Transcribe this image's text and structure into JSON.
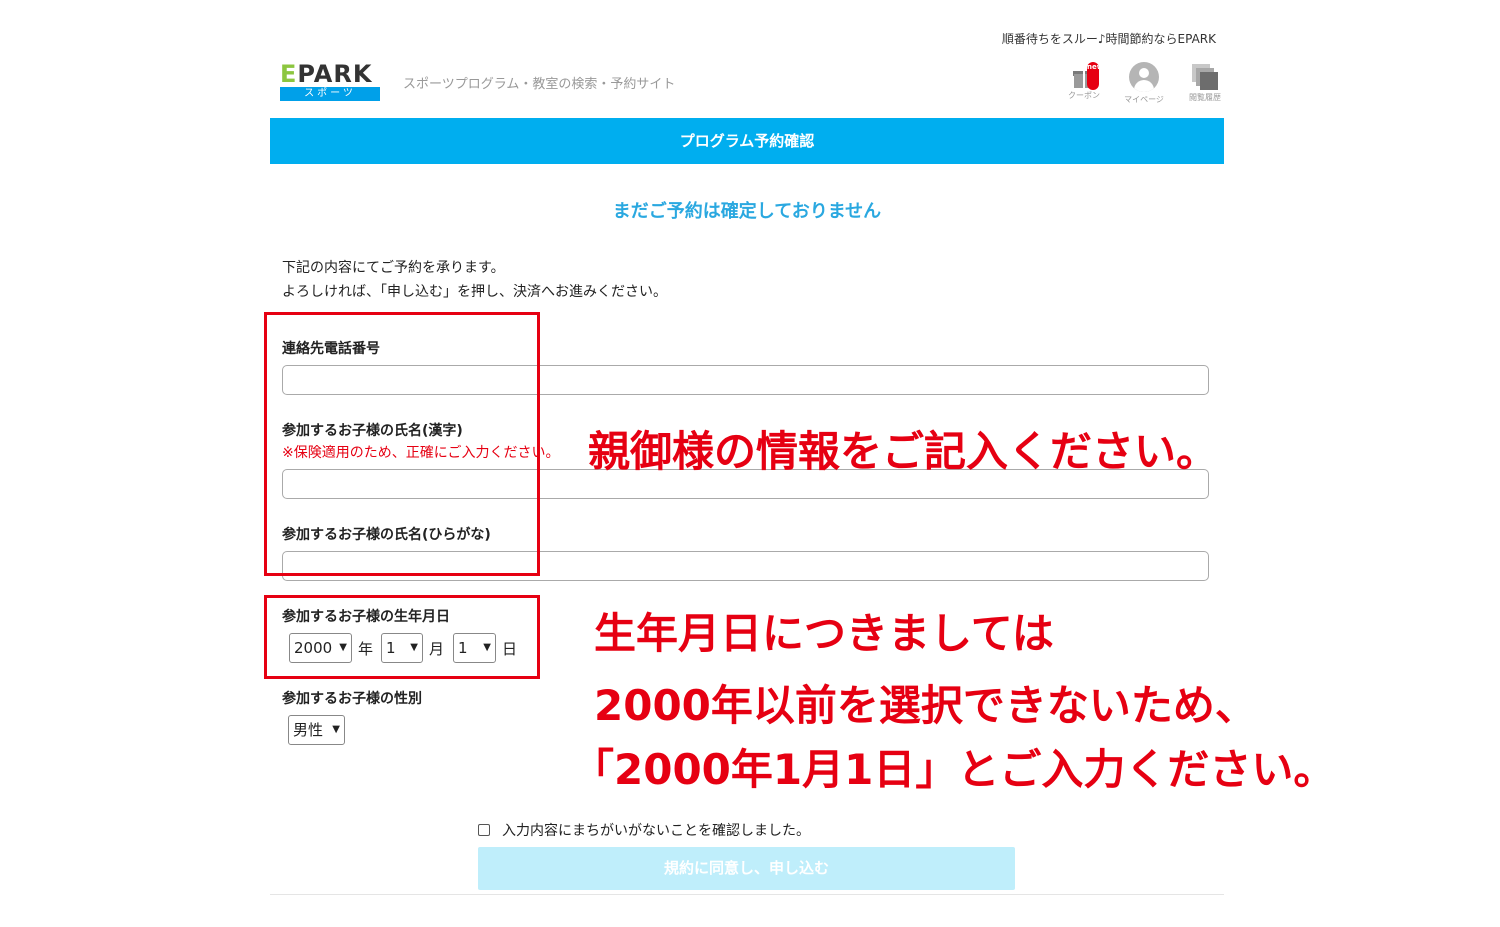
{
  "header": {
    "tagline": "順番待ちをスルー♪時間節約ならEPARK",
    "logo_letter": "E",
    "logo_word": "PARK",
    "logo_sub": "スポーツ",
    "site_description": "スポーツプログラム・教室の検索・予約サイト",
    "icons": [
      {
        "name": "gift-icon",
        "label": "クーポン",
        "badge": "new"
      },
      {
        "name": "user-icon",
        "label": "マイページ"
      },
      {
        "name": "history-icon",
        "label": "閲覧履歴"
      }
    ]
  },
  "banner": {
    "title": "プログラム予約確認"
  },
  "notice": "まだご予約は確定しておりません",
  "intro": {
    "line1": "下記の内容にてご予約を承ります。",
    "line2": "よろしければ、「申し込む」を押し、決済へお進みください。"
  },
  "form": {
    "phone_label": "連絡先電話番号",
    "phone_value": "",
    "name_kanji_label": "参加するお子様の氏名(漢字)",
    "name_kanji_warning": "※保険適用のため、正確にご入力ください。",
    "name_kanji_value": "",
    "name_kana_label": "参加するお子様の氏名(ひらがな)",
    "name_kana_value": "",
    "birthdate_label": "参加するお子様の生年月日",
    "birth_year": "2000",
    "year_unit": "年",
    "birth_month": "1",
    "month_unit": "月",
    "birth_day": "1",
    "day_unit": "日",
    "gender_label": "参加するお子様の性別",
    "gender": "男性",
    "confirm_checkbox_label": "入力内容にまちがいがないことを確認しました。",
    "confirm_checked": false,
    "submit_label": "規約に同意し、申し込む"
  },
  "annotations": {
    "parent_info": "親御様の情報をご記入ください。",
    "birthdate_line1": "生年月日につきましては",
    "birthdate_line2": "2000年以前を選択できないため、",
    "birthdate_line3": "「2000年1月1日」とご入力ください。"
  },
  "colors": {
    "brand_blue": "#00aeef",
    "notice_blue": "#2aa8e0",
    "annotation_red": "#e60012",
    "logo_green": "#8cc63f",
    "submit_disabled": "#bfeefb"
  }
}
